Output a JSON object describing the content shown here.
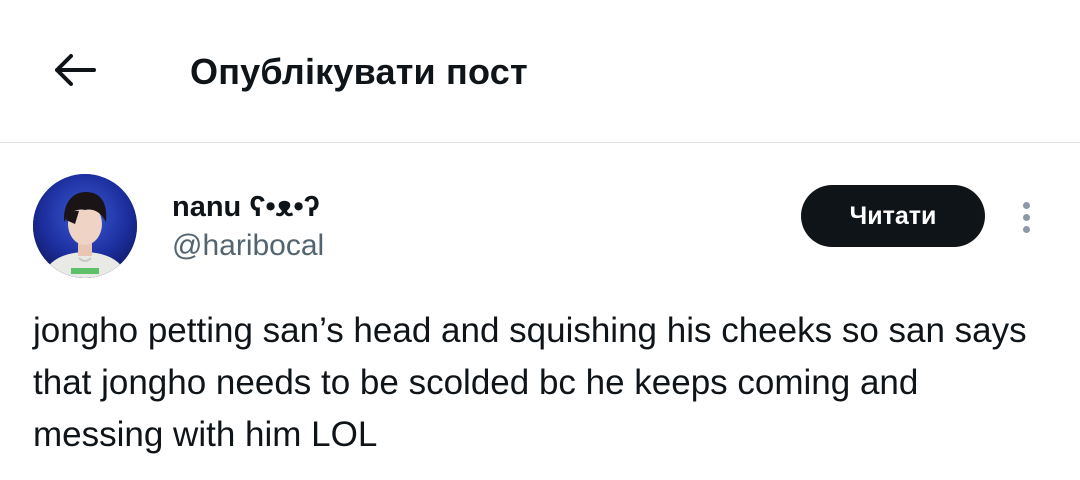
{
  "header": {
    "title": "Опублікувати пост",
    "back_icon": "arrow-left-icon"
  },
  "post": {
    "author": {
      "display_name": "nanu ʕ•ᴥ•ʔ",
      "handle": "@haribocal"
    },
    "follow_label": "Читати",
    "more_icon": "more-vertical-icon",
    "text": "jongho petting san’s head and squishing his cheeks so san says that jongho needs to be scolded bc he keeps coming and messing with him LOL"
  },
  "colors": {
    "primary_text": "#0f1419",
    "secondary_text": "#536471",
    "button_bg": "#0f1419",
    "divider": "#e1e4e8"
  }
}
